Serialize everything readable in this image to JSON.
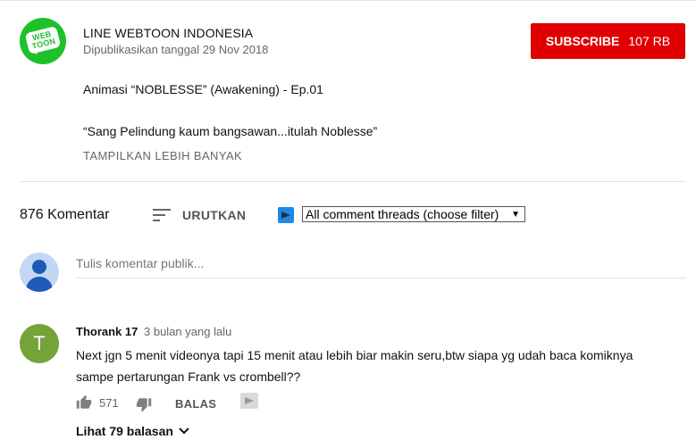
{
  "channel": {
    "logo_text_line1": "WEB",
    "logo_text_line2": "TOON",
    "name": "LINE WEBTOON INDONESIA",
    "published": "Dipublikasikan tanggal 29 Nov 2018",
    "brand_color": "#1fc12a"
  },
  "subscribe": {
    "label": "SUBSCRIBE",
    "count": "107 RB",
    "color": "#e00000"
  },
  "description": {
    "line1": "Animasi “NOBLESSE” (Awakening) -  Ep.01",
    "line2": "“Sang Pelindung kaum bangsawan...itulah Noblesse”",
    "show_more": "TAMPILKAN LEBIH BANYAK"
  },
  "comments_header": {
    "count_label": "876 Komentar",
    "sort_label": "URUTKAN",
    "filter_selected": "All comment threads (choose filter)"
  },
  "new_comment": {
    "placeholder": "Tulis komentar publik..."
  },
  "comments": [
    {
      "avatar_letter": "T",
      "avatar_color": "#74a33a",
      "author": "Thorank 17",
      "time": "3 bulan yang lalu",
      "text_line1": "Next jgn 5 menit videonya tapi 15 menit atau lebih biar makin seru,btw siapa yg udah baca komiknya",
      "text_line2": "sampe pertarungan Frank vs crombell??",
      "likes": "571",
      "reply_label": "BALAS",
      "view_replies": "Lihat 79 balasan"
    }
  ],
  "icons": [
    "sort-icon",
    "filter-icon",
    "thumbs-up-icon",
    "thumbs-down-icon",
    "chevron-down-icon",
    "avatar-icon"
  ]
}
